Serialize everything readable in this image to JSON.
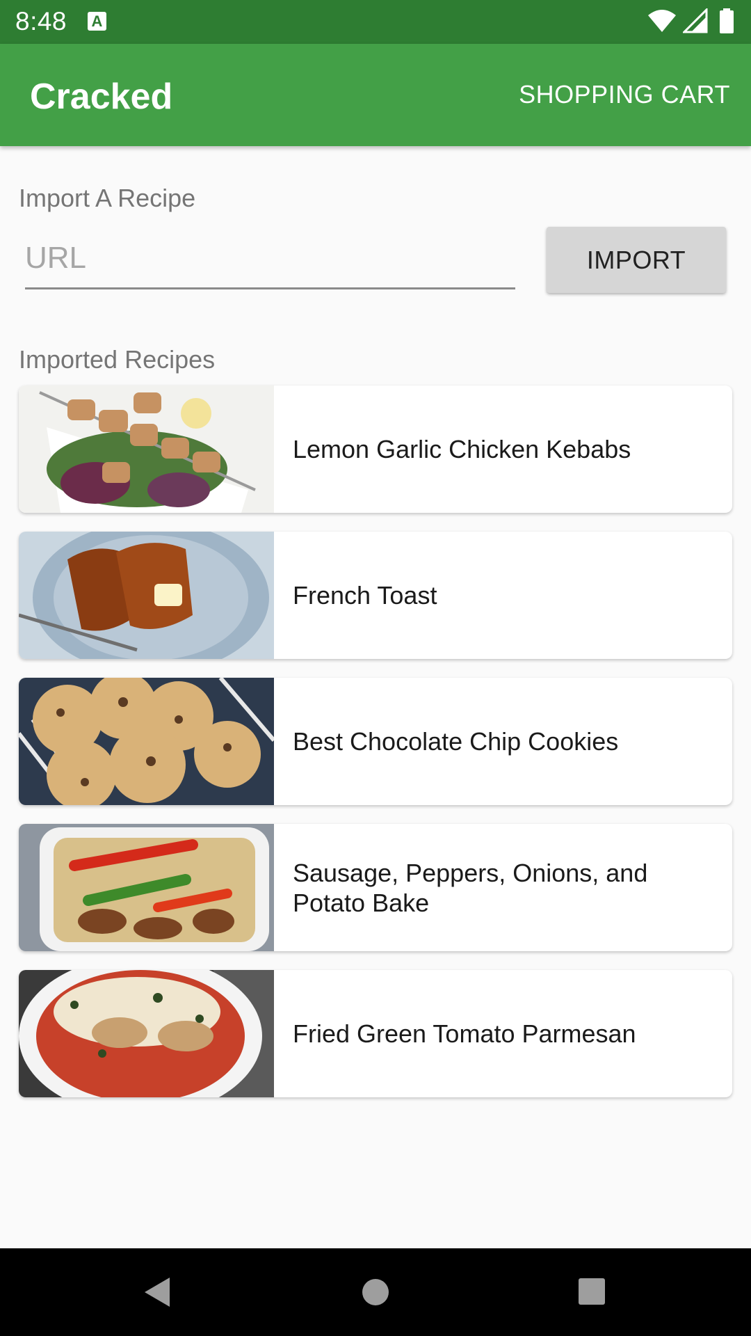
{
  "status_bar": {
    "time": "8:48",
    "icons": [
      "a-notification-icon",
      "wifi-icon",
      "signal-icon",
      "battery-icon"
    ],
    "color": "#2e7d32"
  },
  "app_bar": {
    "title": "Cracked",
    "cart_label": "SHOPPING CART",
    "color": "#43a047"
  },
  "import_section": {
    "label": "Import A Recipe",
    "url_placeholder": "URL",
    "url_value": "",
    "import_label": "IMPORT"
  },
  "recipes_section": {
    "label": "Imported Recipes",
    "items": [
      {
        "title": "Lemon Garlic Chicken Kebabs"
      },
      {
        "title": "French Toast"
      },
      {
        "title": "Best Chocolate Chip Cookies"
      },
      {
        "title": "Sausage, Peppers, Onions, and Potato Bake"
      },
      {
        "title": "Fried Green Tomato Parmesan"
      }
    ]
  },
  "nav_bar": {
    "icons": [
      "back-icon",
      "home-icon",
      "recents-icon"
    ]
  }
}
